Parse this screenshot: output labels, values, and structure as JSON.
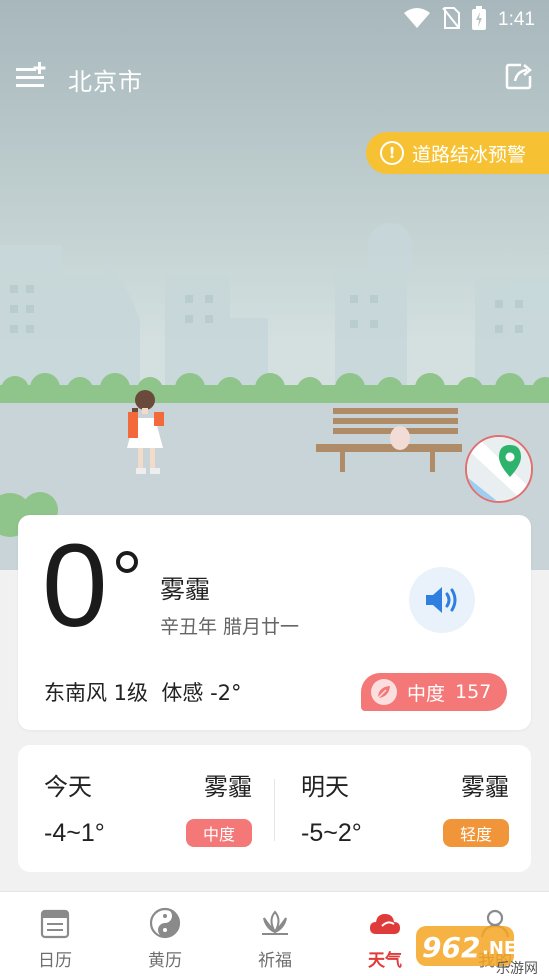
{
  "status": {
    "time": "1:41"
  },
  "header": {
    "city": "北京市"
  },
  "alert": {
    "text": "道路结冰预警",
    "color": "#f6c233"
  },
  "current": {
    "temperature": "0",
    "condition": "雾霾",
    "lunar_date": "辛丑年 腊月廿一",
    "wind": "东南风 1级",
    "feels_like": "体感 -2°",
    "aqi_level": "中度",
    "aqi_value": "157",
    "aqi_color": "#f47878"
  },
  "forecast": [
    {
      "day": "今天",
      "condition": "雾霾",
      "range": "-4~1°",
      "tag": "中度",
      "tag_color": "#f47878"
    },
    {
      "day": "明天",
      "condition": "雾霾",
      "range": "-5~2°",
      "tag": "轻度",
      "tag_color": "#f0953a"
    }
  ],
  "tabs": [
    {
      "label": "日历",
      "icon": "calendar-icon",
      "active": false
    },
    {
      "label": "黄历",
      "icon": "yin-yang-icon",
      "active": false
    },
    {
      "label": "祈福",
      "icon": "lotus-icon",
      "active": false
    },
    {
      "label": "天气",
      "icon": "weather-icon",
      "active": true
    },
    {
      "label": "我的",
      "icon": "profile-icon",
      "active": false
    }
  ],
  "watermark": {
    "brand": "962",
    "suffix": ".NET",
    "sub": "乐游网"
  },
  "colors": {
    "accent_red": "#e03b3b",
    "speaker_blue": "#2f7fe0"
  }
}
